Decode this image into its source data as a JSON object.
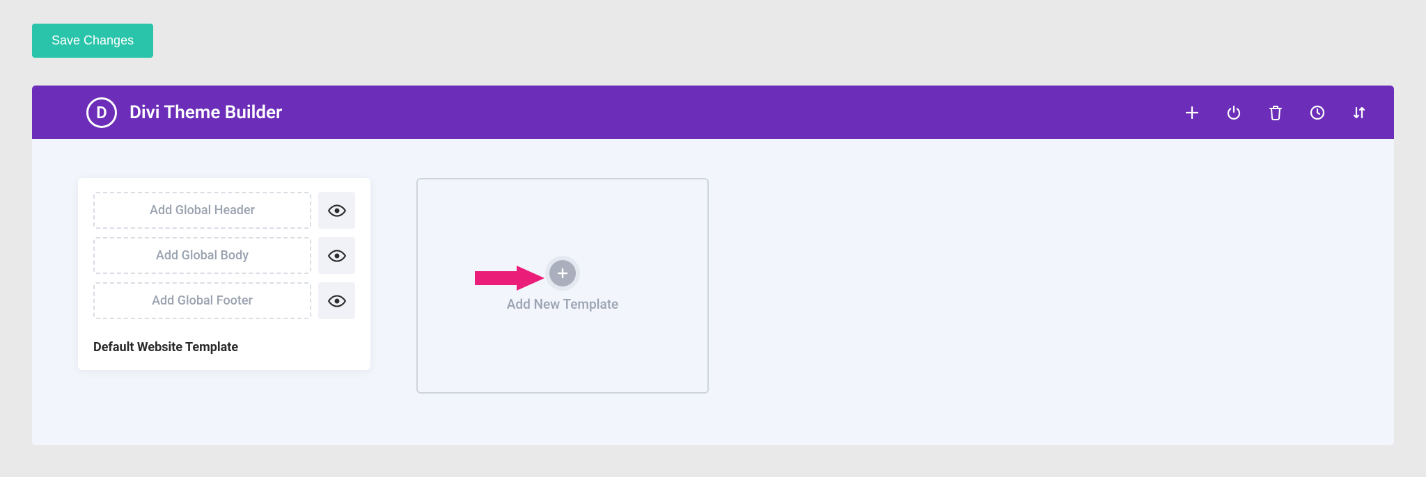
{
  "save_button": "Save Changes",
  "header": {
    "logo_letter": "D",
    "title": "Divi Theme Builder"
  },
  "default_template": {
    "header_slot": "Add Global Header",
    "body_slot": "Add Global Body",
    "footer_slot": "Add Global Footer",
    "label": "Default Website Template"
  },
  "new_template": {
    "label": "Add New Template"
  },
  "colors": {
    "accent_teal": "#29c4a9",
    "accent_purple": "#6c2eb9",
    "annotation_pink": "#ea1e79"
  }
}
